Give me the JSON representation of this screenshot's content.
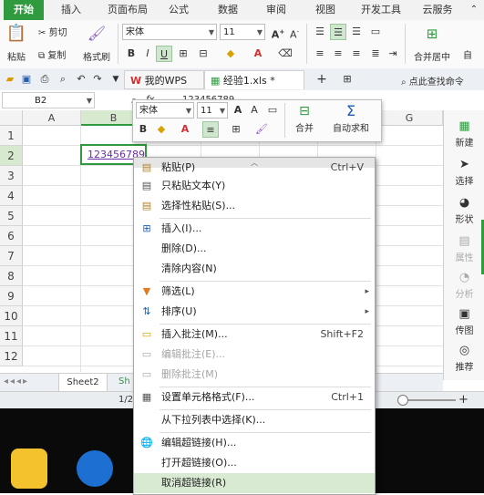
{
  "ribbon_tabs": [
    "开始",
    "插入",
    "页面布局",
    "公式",
    "数据",
    "审阅",
    "视图",
    "开发工具",
    "云服务"
  ],
  "ribbon": {
    "paste": "粘贴",
    "cut": "剪切",
    "copy": "复制",
    "format_painter": "格式刷",
    "font": "宋体",
    "font_size": "11",
    "merge_center": "合并居中",
    "auto_wrap": "自"
  },
  "doc_tabs": {
    "wps": "我的WPS",
    "file": "经验1.xls *",
    "search": "点此查找命令"
  },
  "formula_bar": {
    "cell_ref": "B2",
    "fx": "fx",
    "value": "123456789"
  },
  "columns": [
    "A",
    "B",
    "C",
    "D",
    "E",
    "F",
    "G"
  ],
  "rows": [
    "1",
    "2",
    "3",
    "4",
    "5",
    "6",
    "7",
    "8",
    "9",
    "10",
    "11",
    "12"
  ],
  "cell_b2": "123456789",
  "mini_toolbar": {
    "font": "宋体",
    "size": "11",
    "merge": "合并",
    "autosum": "自动求和"
  },
  "context_menu": [
    {
      "label": "粘贴(P)",
      "shortcut": "Ctrl+V",
      "icon": "paste-icon",
      "disabled": false
    },
    {
      "label": "只粘贴文本(Y)",
      "shortcut": "",
      "icon": "paste-text-icon",
      "disabled": false
    },
    {
      "label": "选择性粘贴(S)...",
      "shortcut": "",
      "icon": "paste-special-icon",
      "disabled": false
    },
    {
      "label": "插入(I)...",
      "shortcut": "",
      "icon": "insert-icon",
      "disabled": false
    },
    {
      "label": "删除(D)...",
      "shortcut": "",
      "icon": "",
      "disabled": false
    },
    {
      "label": "清除内容(N)",
      "shortcut": "",
      "icon": "",
      "disabled": false
    },
    {
      "label": "筛选(L)",
      "shortcut": "",
      "icon": "filter-icon",
      "disabled": false,
      "submenu": true
    },
    {
      "label": "排序(U)",
      "shortcut": "",
      "icon": "sort-icon",
      "disabled": false,
      "submenu": true
    },
    {
      "label": "插入批注(M)...",
      "shortcut": "Shift+F2",
      "icon": "comment-icon",
      "disabled": false
    },
    {
      "label": "编辑批注(E)...",
      "shortcut": "",
      "icon": "edit-comment-icon",
      "disabled": true
    },
    {
      "label": "删除批注(M)",
      "shortcut": "",
      "icon": "delete-comment-icon",
      "disabled": true
    },
    {
      "label": "设置单元格格式(F)...",
      "shortcut": "Ctrl+1",
      "icon": "format-cells-icon",
      "disabled": false
    },
    {
      "label": "从下拉列表中选择(K)...",
      "shortcut": "",
      "icon": "",
      "disabled": false
    },
    {
      "label": "编辑超链接(H)...",
      "shortcut": "",
      "icon": "hyperlink-icon",
      "disabled": false
    },
    {
      "label": "打开超链接(O)...",
      "shortcut": "",
      "icon": "",
      "disabled": false
    },
    {
      "label": "取消超链接(R)",
      "shortcut": "",
      "icon": "",
      "disabled": false
    }
  ],
  "right_panel": [
    "新建",
    "选择",
    "形状",
    "属性",
    "分析",
    "传图",
    "推荐"
  ],
  "sheet_tabs": [
    "Sheet2",
    "Sh"
  ],
  "status": {
    "page": "1/2"
  },
  "colors": {
    "accent": "#2f9b3e",
    "highlight": "#d9ead3"
  }
}
